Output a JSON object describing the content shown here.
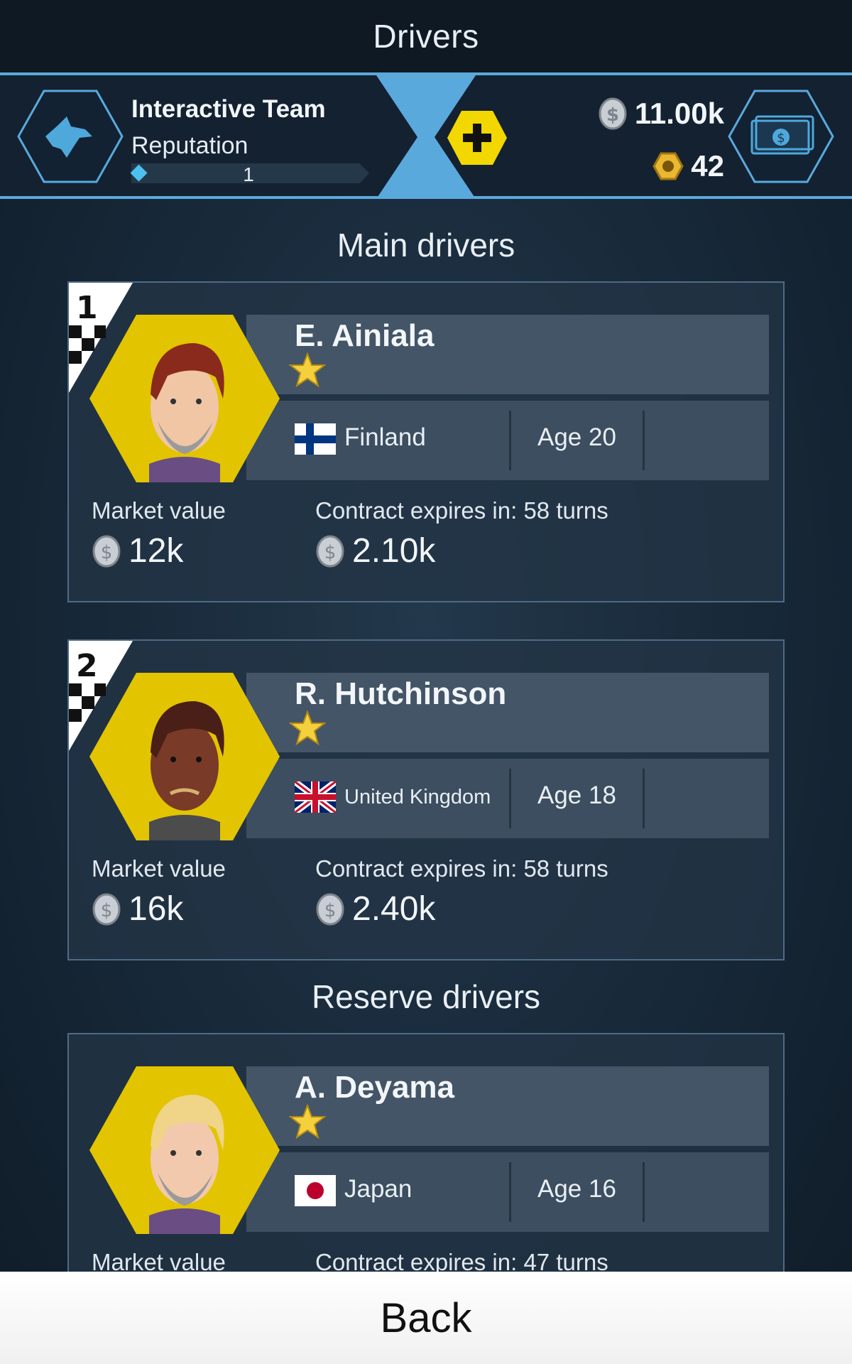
{
  "header": {
    "title": "Drivers"
  },
  "team": {
    "name": "Interactive Team",
    "reputation_label": "Reputation",
    "reputation_level": "1",
    "silver_coins": "11.00k",
    "gold_nuts": "42",
    "team_icon": "wolf-icon",
    "shop_icon": "cash-icon",
    "add_icon": "plus-icon"
  },
  "sections": {
    "main": "Main drivers",
    "reserve": "Reserve drivers"
  },
  "drivers": [
    {
      "rank": "1",
      "name": "E. Ainiala",
      "stars": 1,
      "country": "Finland",
      "age": "Age 20",
      "market_label": "Market value",
      "market_value": "12k",
      "contract_label": "Contract expires in: 58 turns",
      "contract_value": "2.10k",
      "hair": "#8a2a1c",
      "skin": "#f0c6a5"
    },
    {
      "rank": "2",
      "name": "R. Hutchinson",
      "stars": 1,
      "country": "United Kingdom",
      "age": "Age 18",
      "market_label": "Market value",
      "market_value": "16k",
      "contract_label": "Contract expires in: 58 turns",
      "contract_value": "2.40k",
      "hair": "#4a1f17",
      "skin": "#7a3a28"
    },
    {
      "rank": "",
      "name": "A. Deyama",
      "stars": 1,
      "country": "Japan",
      "age": "Age 16",
      "market_label": "Market value",
      "market_value": "",
      "contract_label": "Contract expires in: 47 turns",
      "contract_value": "",
      "hair": "#f0d488",
      "skin": "#f2c9ad"
    }
  ],
  "footer": {
    "back_label": "Back"
  },
  "colors": {
    "accent": "#5aa9dc",
    "hex_yellow": "#e2c400",
    "star": "#f4d03f"
  }
}
